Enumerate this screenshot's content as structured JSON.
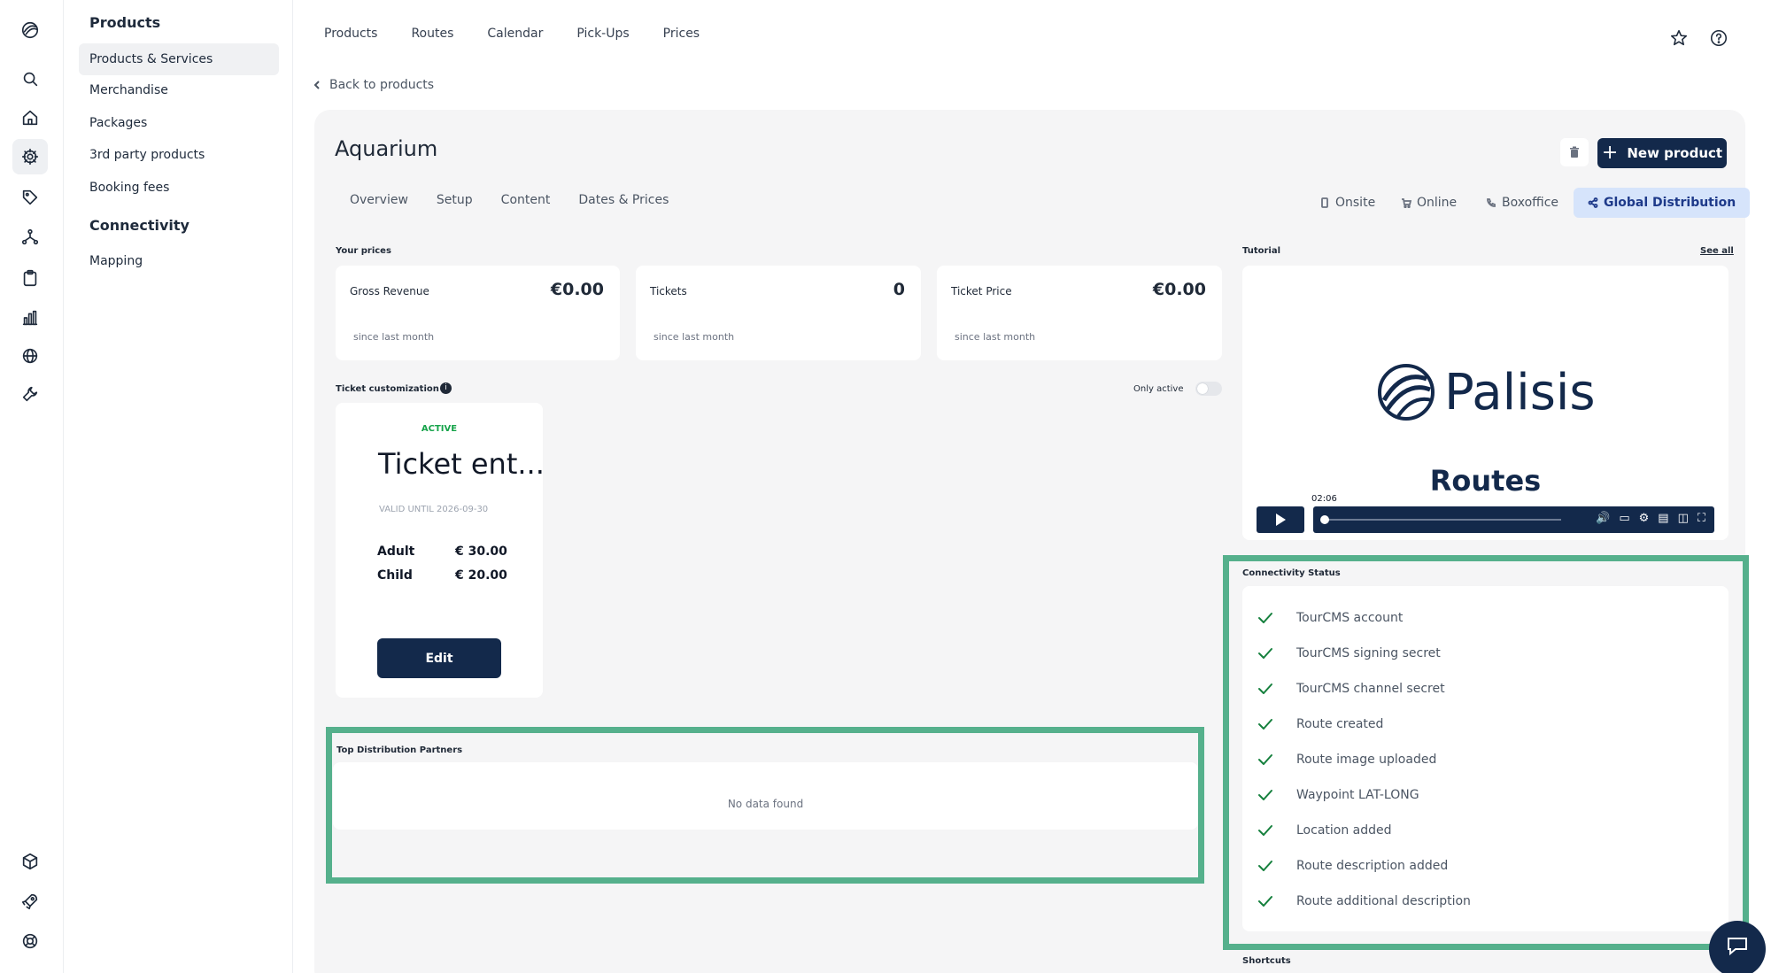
{
  "sidebar": {
    "section_products": "Products",
    "items": [
      "Products & Services",
      "Merchandise",
      "Packages",
      "3rd party products",
      "Booking fees"
    ],
    "section_connectivity": "Connectivity",
    "connectivity_items": [
      "Mapping"
    ]
  },
  "topnav": [
    "Products",
    "Routes",
    "Calendar",
    "Pick-Ups",
    "Prices"
  ],
  "back_label": "Back to products",
  "product": {
    "title": "Aquarium",
    "new_button": "New product",
    "tabs": [
      "Overview",
      "Setup",
      "Content",
      "Dates & Prices"
    ],
    "channels": [
      "Onsite",
      "Online",
      "Boxoffice",
      "Global Distribution"
    ]
  },
  "prices": {
    "label": "Your prices",
    "cards": [
      {
        "label": "Gross Revenue",
        "value": "€0.00",
        "sub": "since last month"
      },
      {
        "label": "Tickets",
        "value": "0",
        "sub": "since last month"
      },
      {
        "label": "Ticket Price",
        "value": "€0.00",
        "sub": "since last month"
      }
    ]
  },
  "tutorial": {
    "label": "Tutorial",
    "see_all": "See all",
    "brand": "Palisis",
    "video_title": "Routes",
    "time": "02:06"
  },
  "ticket_customization": {
    "label": "Ticket customization",
    "only_active": "Only active",
    "info": "i",
    "ticket": {
      "status": "ACTIVE",
      "name": "Ticket ent...",
      "valid": "VALID UNTIL 2026-09-30",
      "rows": [
        {
          "name": "Adult",
          "price": "€ 30.00"
        },
        {
          "name": "Child",
          "price": "€ 20.00"
        }
      ],
      "edit": "Edit"
    }
  },
  "distribution": {
    "label": "Top Distribution Partners",
    "empty": "No data found"
  },
  "connectivity": {
    "label": "Connectivity Status",
    "items": [
      "TourCMS account",
      "TourCMS signing secret",
      "TourCMS channel secret",
      "Route created",
      "Route image uploaded",
      "Waypoint LAT-LONG",
      "Location added",
      "Route description added",
      "Route additional description"
    ]
  },
  "shortcuts_label": "Shortcuts",
  "colors": {
    "primary": "#13294b",
    "highlight": "#55b08c",
    "success": "#15803d",
    "active_channel_bg": "#d6e4fb"
  }
}
